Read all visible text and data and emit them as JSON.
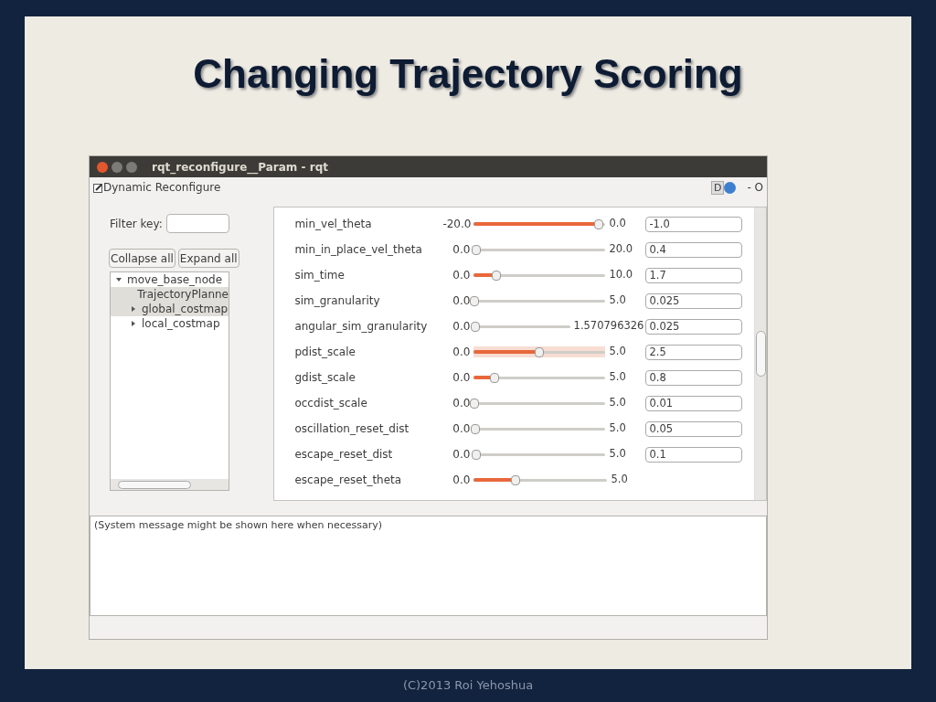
{
  "slide": {
    "title": "Changing Trajectory Scoring",
    "footer": "(C)2013 Roi Yehoshua"
  },
  "window": {
    "title": "rqt_reconfigure__Param - rqt",
    "plugin_title": "Dynamic Reconfigure",
    "right_controls": [
      "D",
      "- O"
    ]
  },
  "filter": {
    "label": "Filter key:"
  },
  "buttons": [
    "Collapse all",
    "Expand all"
  ],
  "tree": [
    {
      "label": "move_base_node",
      "kind": "group",
      "expanded": true,
      "selected": false,
      "children": [
        {
          "label": "TrajectoryPlanne",
          "kind": "leaf",
          "expanded": false,
          "selected": true
        },
        {
          "label": "global_costmap",
          "kind": "group",
          "expanded": false,
          "selected": true
        },
        {
          "label": "local_costmap",
          "kind": "group",
          "expanded": false,
          "selected": false
        }
      ]
    }
  ],
  "params": [
    {
      "name": "min_vel_theta",
      "min": "-20.0",
      "max": "0.0",
      "level": 0.95,
      "value": "-1.0",
      "highlighted": false
    },
    {
      "name": "min_in_place_vel_theta",
      "min": "0.0",
      "max": "20.0",
      "level": 0.02,
      "value": "0.4",
      "highlighted": false
    },
    {
      "name": "sim_time",
      "min": "0.0",
      "max": "10.0",
      "level": 0.17,
      "value": "1.7",
      "highlighted": false
    },
    {
      "name": "sim_granularity",
      "min": "0.0",
      "max": "5.0",
      "level": 0.005,
      "value": "0.025",
      "highlighted": false
    },
    {
      "name": "angular_sim_granularity",
      "min": "0.0",
      "max": "1.570796326",
      "level": 0.016,
      "value": "0.025",
      "highlighted": false
    },
    {
      "name": "pdist_scale",
      "min": "0.0",
      "max": "5.0",
      "level": 0.5,
      "value": "2.5",
      "highlighted": true
    },
    {
      "name": "gdist_scale",
      "min": "0.0",
      "max": "5.0",
      "level": 0.16,
      "value": "0.8",
      "highlighted": false
    },
    {
      "name": "occdist_scale",
      "min": "0.0",
      "max": "5.0",
      "level": 0.002,
      "value": "0.01",
      "highlighted": false
    },
    {
      "name": "oscillation_reset_dist",
      "min": "0.0",
      "max": "5.0",
      "level": 0.01,
      "value": "0.05",
      "highlighted": false
    },
    {
      "name": "escape_reset_dist",
      "min": "0.0",
      "max": "5.0",
      "level": 0.02,
      "value": "0.1",
      "highlighted": false
    },
    {
      "name": "escape_reset_theta",
      "min": "0.0",
      "max": "5.0",
      "level": 0.31,
      "highlighted": false
    }
  ],
  "message": "(System message might be shown here when necessary)"
}
